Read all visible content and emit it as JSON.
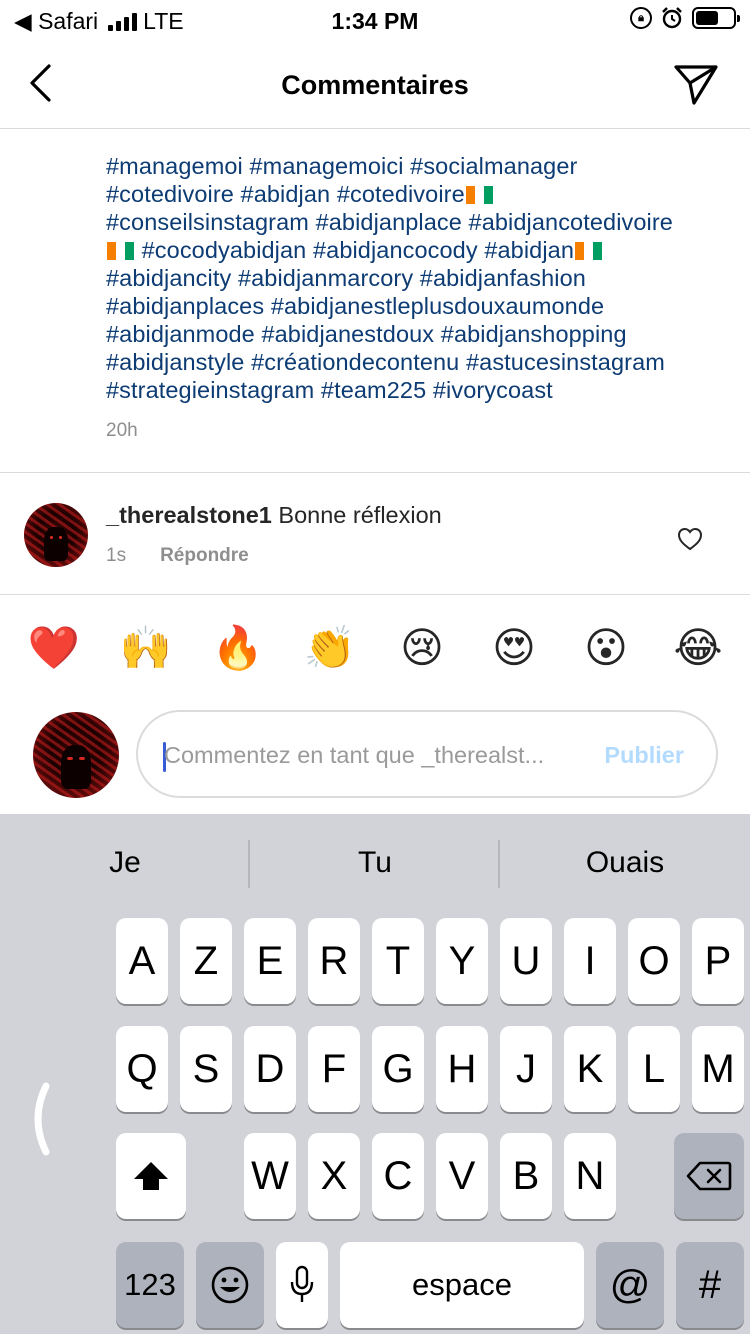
{
  "status_bar": {
    "back_app": "◀ Safari",
    "network": "LTE",
    "time": "1:34 PM"
  },
  "header": {
    "title": "Commentaires"
  },
  "caption": {
    "lines": [
      "#managemoi #managemoici #socialmanager",
      "#cotedivoire #abidjan #cotedivoire",
      "#conseilsinstagram #abidjanplace #abidjancotedivoire",
      " #cocodyabidjan #abidjancocody #abidjan",
      "#abidjancity #abidjanmarcory #abidjanfashion",
      "#abidjanplaces #abidjanestleplusdouxaumonde",
      "#abidjanmode #abidjanestdoux #abidjanshopping",
      "#abidjanstyle #créationdecontenu #astucesinstagram",
      "#strategieinstagram #team225 #ivorycoast"
    ],
    "time": "20h",
    "flag_colors": [
      "#f77f00",
      "#ffffff",
      "#009e60"
    ]
  },
  "comment": {
    "username": "_therealstone1",
    "text": "Bonne réflexion",
    "time": "1s",
    "reply_label": "Répondre"
  },
  "emoji_bar": {
    "emojis": [
      "❤️",
      "🙌",
      "🔥",
      "👏",
      "😢",
      "😍",
      "😮",
      "😂"
    ]
  },
  "comment_input": {
    "placeholder": "Commentez en tant que _therealst...",
    "publish_label": "Publier"
  },
  "keyboard": {
    "suggestions": [
      "Je",
      "Tu",
      "Ouais"
    ],
    "row1": [
      "A",
      "Z",
      "E",
      "R",
      "T",
      "Y",
      "U",
      "I",
      "O",
      "P"
    ],
    "row2": [
      "Q",
      "S",
      "D",
      "F",
      "G",
      "H",
      "J",
      "K",
      "L",
      "M"
    ],
    "row3": [
      "W",
      "X",
      "C",
      "V",
      "B",
      "N"
    ],
    "numbers_label": "123",
    "space_label": "espace",
    "at_label": "@",
    "hash_label": "#"
  }
}
